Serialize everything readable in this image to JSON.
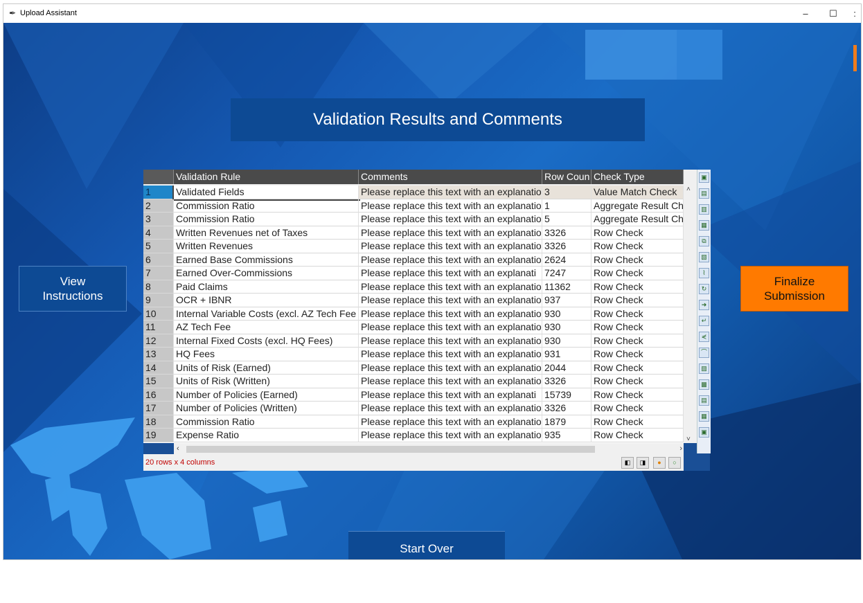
{
  "window": {
    "title": "Upload Assistant",
    "minimize": "–",
    "maximize": "☐",
    "close": ":"
  },
  "header": {
    "title": "Validation Results and Comments"
  },
  "buttons": {
    "view_instructions": "View\nInstructions",
    "finalize_submission": "Finalize\nSubmission",
    "start_over": "Start Over"
  },
  "table": {
    "columns": [
      "Validation Rule",
      "Comments",
      "Row Coun",
      "Check Type"
    ],
    "rows": [
      [
        "1",
        "Validated Fields",
        "Please replace this text with an explanatio",
        "3",
        "Value Match Check"
      ],
      [
        "2",
        "Commission Ratio",
        "Please replace this text with an explanatio",
        "1",
        "Aggregate Result Ch"
      ],
      [
        "3",
        "Commission Ratio",
        "Please replace this text with an explanatio",
        "5",
        "Aggregate Result Ch"
      ],
      [
        "4",
        "Written Revenues net of Taxes",
        "Please replace this text with an explanatio",
        "3326",
        "Row Check"
      ],
      [
        "5",
        "Written Revenues",
        "Please replace this text with an explanatio",
        "3326",
        "Row Check"
      ],
      [
        "6",
        "Earned Base Commissions",
        "Please replace this text with an explanatio",
        "2624",
        "Row Check"
      ],
      [
        "7",
        "Earned Over-Commissions",
        "Please replace this text with an explanati",
        "7247",
        "Row Check"
      ],
      [
        "8",
        "Paid Claims",
        "Please replace this text with an explanatio",
        "11362",
        "Row Check"
      ],
      [
        "9",
        "OCR + IBNR",
        "Please replace this text with an explanatio",
        "937",
        "Row Check"
      ],
      [
        "10",
        "Internal Variable Costs (excl. AZ Tech Fee",
        "Please replace this text with an explanatio",
        "930",
        "Row Check"
      ],
      [
        "11",
        "AZ Tech Fee",
        "Please replace this text with an explanatio",
        "930",
        "Row Check"
      ],
      [
        "12",
        "Internal Fixed Costs (excl. HQ Fees)",
        "Please replace this text with an explanatio",
        "930",
        "Row Check"
      ],
      [
        "13",
        "HQ Fees",
        "Please replace this text with an explanatio",
        "931",
        "Row Check"
      ],
      [
        "14",
        "Units of Risk (Earned)",
        "Please replace this text with an explanatio",
        "2044",
        "Row Check"
      ],
      [
        "15",
        "Units of Risk (Written)",
        "Please replace this text with an explanatio",
        "3326",
        "Row Check"
      ],
      [
        "16",
        "Number of Policies (Earned)",
        "Please replace this text with an explanati",
        "15739",
        "Row Check"
      ],
      [
        "17",
        "Number of Policies (Written)",
        "Please replace this text with an explanatio",
        "3326",
        "Row Check"
      ],
      [
        "18",
        "Commission Ratio",
        "Please replace this text with an explanatio",
        "1879",
        "Row Check"
      ],
      [
        "19",
        "Expense Ratio",
        "Please replace this text with an explanatio",
        "935",
        "Row Check"
      ]
    ],
    "status": "20 rows x 4 columns",
    "selected_row": "1"
  },
  "colors": {
    "accent_orange": "#ff7a00",
    "panel_blue": "#0d4a94",
    "status_red": "#c00000"
  },
  "icons": [
    "feather-icon",
    "scroll-up-icon",
    "scroll-down-icon",
    "scroll-left-icon",
    "scroll-right-icon"
  ]
}
